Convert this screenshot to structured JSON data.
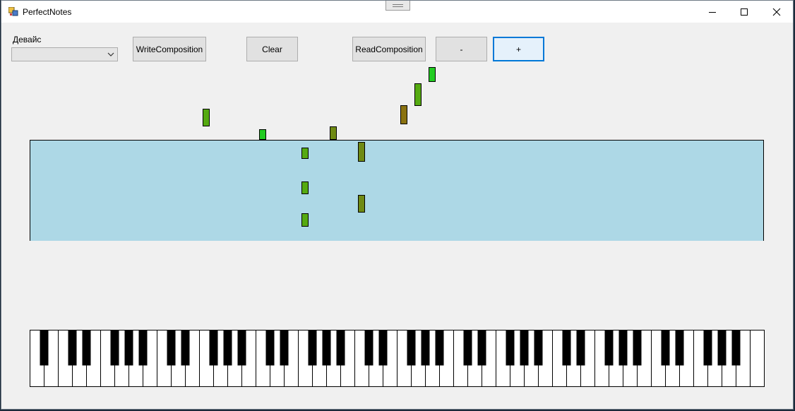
{
  "window": {
    "title": "PerfectNotes"
  },
  "device": {
    "label": "Девайс",
    "selected": ""
  },
  "toolbar": {
    "write_label": "WriteComposition",
    "clear_label": "Clear",
    "read_label": "ReadComposition",
    "minus_label": "-",
    "plus_label": "+"
  },
  "colors": {
    "note_bright": "#22cc22",
    "note_green": "#55aa11",
    "note_olive": "#6f8a14",
    "note_brown": "#8a7210",
    "staff_bg": "#add8e6",
    "focus_accent": "#0078d7"
  },
  "icons": [
    "app-icon",
    "minimize-icon",
    "maximize-icon",
    "close-icon",
    "chevron-down-icon"
  ],
  "piano": {
    "white_keys": 52
  }
}
